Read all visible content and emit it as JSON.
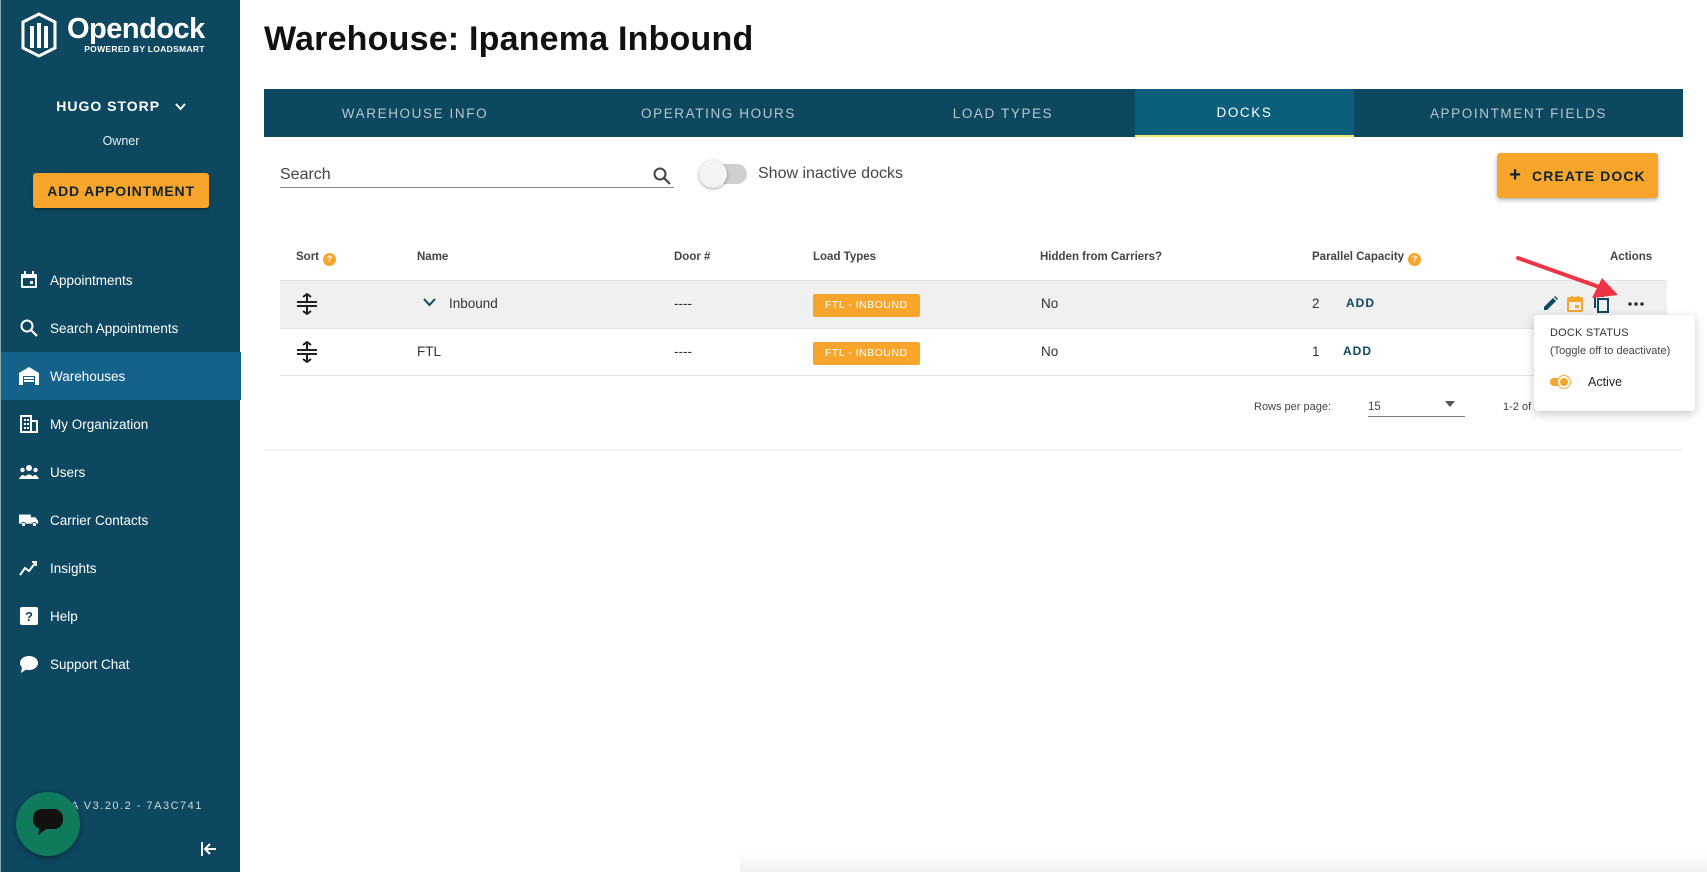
{
  "brand": {
    "name": "Opendock",
    "subtitle": "POWERED BY LOADSMART"
  },
  "user": {
    "name": "HUGO STORP",
    "role": "Owner"
  },
  "sidebar": {
    "add_appointment_label": "ADD APPOINTMENT",
    "items": [
      {
        "label": "Appointments",
        "icon": "calendar-icon",
        "active": false
      },
      {
        "label": "Search Appointments",
        "icon": "search-icon",
        "active": false
      },
      {
        "label": "Warehouses",
        "icon": "warehouse-icon",
        "active": true
      },
      {
        "label": "My Organization",
        "icon": "building-icon",
        "active": false
      },
      {
        "label": "Users",
        "icon": "users-icon",
        "active": false
      },
      {
        "label": "Carrier Contacts",
        "icon": "truck-icon",
        "active": false
      },
      {
        "label": "Insights",
        "icon": "chart-line-icon",
        "active": false
      },
      {
        "label": "Help",
        "icon": "help-icon",
        "active": false
      },
      {
        "label": "Support Chat",
        "icon": "chat-bubble-icon",
        "active": false
      }
    ],
    "version": "VA V3.20.2 - 7A3C741"
  },
  "page": {
    "title": "Warehouse: Ipanema Inbound"
  },
  "tabs": [
    {
      "label": "WAREHOUSE INFO",
      "active": false
    },
    {
      "label": "OPERATING HOURS",
      "active": false
    },
    {
      "label": "LOAD TYPES",
      "active": false
    },
    {
      "label": "DOCKS",
      "active": true
    },
    {
      "label": "APPOINTMENT FIELDS",
      "active": false
    }
  ],
  "toolbar": {
    "search_placeholder": "Search",
    "show_inactive_label": "Show inactive docks",
    "show_inactive_on": false,
    "create_dock_label": "CREATE DOCK"
  },
  "table": {
    "headers": {
      "sort": "Sort",
      "name": "Name",
      "door": "Door #",
      "load_types": "Load Types",
      "hidden": "Hidden from Carriers?",
      "capacity": "Parallel Capacity",
      "actions": "Actions"
    },
    "rows": [
      {
        "name": "Inbound",
        "door": "----",
        "load_type": "FTL - INBOUND",
        "hidden": "No",
        "capacity": "2",
        "add_label": "ADD",
        "expandable": true
      },
      {
        "name": "FTL",
        "door": "----",
        "load_type": "FTL - INBOUND",
        "hidden": "No",
        "capacity": "1",
        "add_label": "ADD",
        "expandable": false
      }
    ],
    "footer": {
      "rows_per_page_label": "Rows per page:",
      "rows_per_page_value": "15",
      "range_text": "1-2 of 2"
    }
  },
  "popover": {
    "title": "DOCK STATUS",
    "hint": "(Toggle off to deactivate)",
    "status_label": "Active",
    "active": true
  },
  "colors": {
    "sidebar": "#0e4760",
    "accent": "#f7a52b",
    "active_nav": "#14628a",
    "annotation_arrow": "#ee3344"
  }
}
